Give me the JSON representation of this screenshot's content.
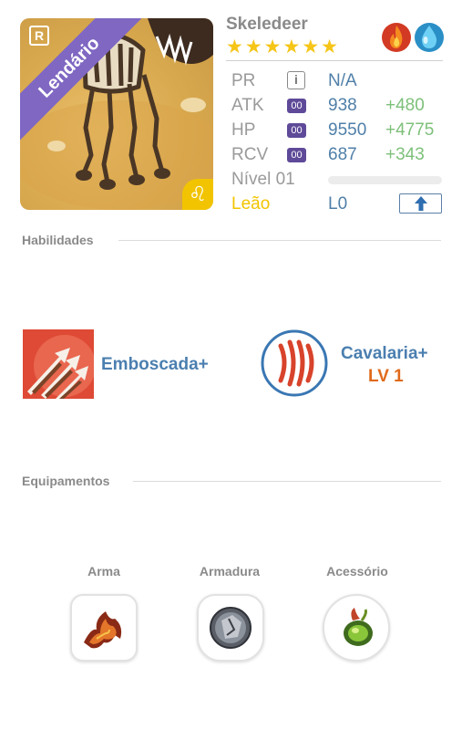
{
  "monster": {
    "name": "Skeledeer",
    "rarity_label": "Lendário",
    "rank_badge": "R",
    "zodiac_symbol": "♌",
    "star_count": 6,
    "elements": [
      "fire-icon",
      "water-icon"
    ]
  },
  "stats": {
    "pr": {
      "label": "PR",
      "value": "N/A",
      "info_icon": "i"
    },
    "atk": {
      "label": "ATK",
      "badge": "00",
      "value": "938",
      "bonus": "+480"
    },
    "hp": {
      "label": "HP",
      "badge": "00",
      "value": "9550",
      "bonus": "+4775"
    },
    "rcv": {
      "label": "RCV",
      "badge": "00",
      "value": "687",
      "bonus": "+343"
    },
    "level": {
      "label": "Nível 01",
      "progress": 0
    },
    "zodiac": {
      "label": "Leão",
      "value": "L0"
    }
  },
  "abilities": {
    "title": "Habilidades",
    "skill_1": {
      "name": "Emboscada+"
    },
    "skill_2": {
      "name": "Cavalaria+",
      "level": "LV 1"
    }
  },
  "equipment": {
    "title": "Equipamentos",
    "slots": [
      {
        "label": "Arma"
      },
      {
        "label": "Armadura"
      },
      {
        "label": "Acessório"
      }
    ]
  },
  "colors": {
    "ribbon": "#7f67c2",
    "stat_value": "#4f7fa8",
    "stat_bonus": "#7ec07a",
    "zodiac": "#f2c400",
    "skill_name": "#4b7fb0",
    "skill_level": "#e06a1b"
  }
}
